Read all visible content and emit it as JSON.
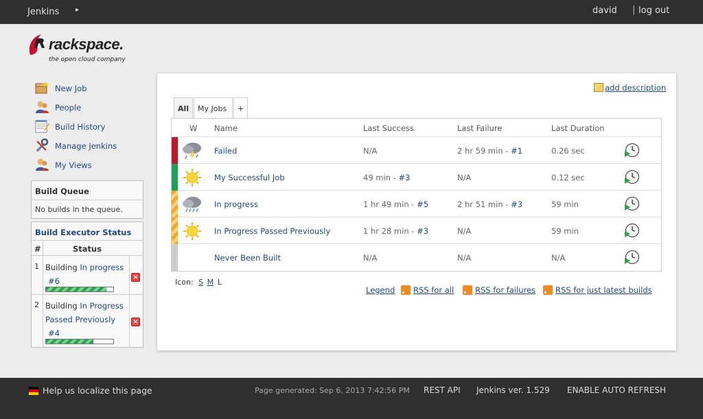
{
  "topbar": {
    "breadcrumb": "Jenkins",
    "breadcrumb_arrow": "▸",
    "username": "david",
    "separator": "|",
    "logout_label": "log out"
  },
  "logo": {
    "brand": "rackspace.",
    "tagline": "the open cloud company"
  },
  "sidebar": {
    "tasks": [
      {
        "label": "New Job",
        "icon": "new-package-icon"
      },
      {
        "label": "People",
        "icon": "user-icon"
      },
      {
        "label": "Build History",
        "icon": "notepad-icon"
      },
      {
        "label": "Manage Jenkins",
        "icon": "wrench-icon"
      },
      {
        "label": "My Views",
        "icon": "user-icon"
      }
    ],
    "build_queue": {
      "title": "Build Queue",
      "empty_text": "No builds in the queue."
    },
    "executors": {
      "title": "Build Executor Status",
      "col_num": "#",
      "col_status": "Status",
      "items": [
        {
          "num": "1",
          "prefix": "Building",
          "job": "In progress",
          "build": "#6",
          "progress": 0.9
        },
        {
          "num": "2",
          "prefix": "Building",
          "job": "In Progress",
          "job2": "Passed Previously",
          "build": "#4",
          "progress": 0.7
        }
      ]
    }
  },
  "main": {
    "add_description": "add description",
    "tabs": [
      {
        "label": "All",
        "active": true
      },
      {
        "label": "My Jobs"
      },
      {
        "label": "+"
      }
    ],
    "columns": {
      "w": "W",
      "name": "Name",
      "last_success": "Last Success",
      "last_failure": "Last Failure",
      "last_duration": "Last Duration"
    },
    "jobs": [
      {
        "status": "red",
        "weather": "storm",
        "name": "Failed",
        "ls": "N/A",
        "ls_build": "",
        "lf": "2 hr 59 min - ",
        "lf_build": "#1",
        "duration": "0.26 sec"
      },
      {
        "status": "green",
        "weather": "sunny",
        "name": "My Successful Job",
        "ls": "49 min - ",
        "ls_build": "#3",
        "lf": "N/A",
        "lf_build": "",
        "duration": "0.12 sec"
      },
      {
        "status": "anime",
        "weather": "cloudy",
        "name": "In progress",
        "ls": "1 hr 49 min - ",
        "ls_build": "#5",
        "lf": "2 hr 51 min - ",
        "lf_build": "#3",
        "duration": "59 min"
      },
      {
        "status": "anime",
        "weather": "sunny",
        "name": "In Progress Passed Previously",
        "ls": "1 hr 28 min - ",
        "ls_build": "#3",
        "lf": "N/A",
        "lf_build": "",
        "duration": "59 min"
      },
      {
        "status": "grey",
        "weather": "none",
        "name": "Never Been Built",
        "ls": "N/A",
        "ls_build": "",
        "lf": "N/A",
        "lf_build": "",
        "duration": "N/A"
      }
    ],
    "icon_size": {
      "label": "Icon:",
      "small": "S",
      "medium": "M",
      "large": "L"
    },
    "feeds": {
      "legend": "Legend",
      "all": "RSS for all",
      "failures": "RSS for failures",
      "latest": "RSS for just latest builds"
    }
  },
  "footer": {
    "localize": "Help us localize this page",
    "generated": "Page generated: Sep 6, 2013 7:42:56 PM",
    "rest_api": "REST API",
    "version": "Jenkins ver. 1.529",
    "auto_refresh": "ENABLE AUTO REFRESH"
  },
  "colors": {
    "link": "#204a87",
    "failed": "#c0182a",
    "success": "#1da25a",
    "in_progress": "#f5a623",
    "not_built": "#cccccc"
  }
}
